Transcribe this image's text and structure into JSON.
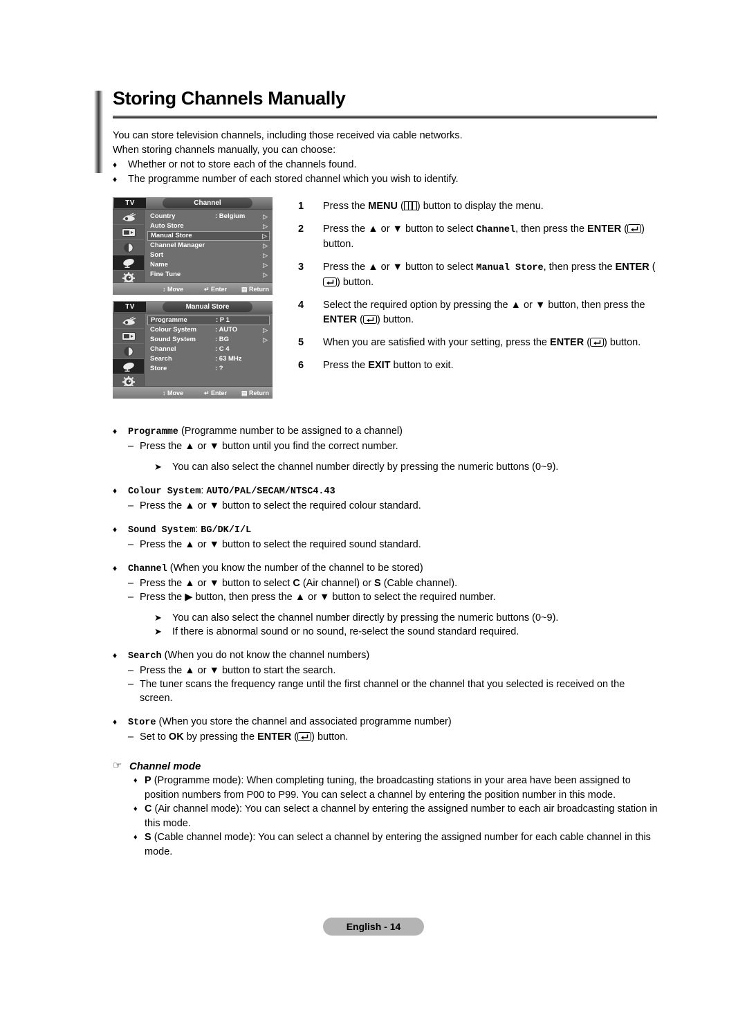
{
  "document": {
    "title": "Storing Channels Manually",
    "intro": [
      "You can store television channels, including those received via cable networks.",
      "When storing channels manually, you can choose:"
    ],
    "intro_bullets": [
      "Whether or not to store each of the channels found.",
      "The programme number of each stored channel which you wish to identify."
    ]
  },
  "osd_menus": [
    {
      "tv_label": "TV",
      "title": "Channel",
      "items": [
        {
          "label": "Country",
          "value": ": Belgium",
          "arrow": "▷",
          "highlighted": false
        },
        {
          "label": "Auto Store",
          "value": "",
          "arrow": "▷",
          "highlighted": false
        },
        {
          "label": "Manual Store",
          "value": "",
          "arrow": "▷",
          "highlighted": true
        },
        {
          "label": "Channel Manager",
          "value": "",
          "arrow": "▷",
          "highlighted": false
        },
        {
          "label": "Sort",
          "value": "",
          "arrow": "▷",
          "highlighted": false
        },
        {
          "label": "Name",
          "value": "",
          "arrow": "▷",
          "highlighted": false
        },
        {
          "label": "Fine Tune",
          "value": "",
          "arrow": "▷",
          "highlighted": false
        }
      ],
      "footer": {
        "move": "Move",
        "enter": "Enter",
        "return": "Return"
      },
      "sidebar_icons": [
        "input-icon",
        "picture-icon",
        "sound-icon",
        "channel-icon",
        "setup-icon"
      ],
      "selected_icon_index": 3
    },
    {
      "tv_label": "TV",
      "title": "Manual Store",
      "items": [
        {
          "label": "Programme",
          "value": ": P   1",
          "arrow": "",
          "highlighted": true
        },
        {
          "label": "Colour System",
          "value": ": AUTO",
          "arrow": "▷",
          "highlighted": false
        },
        {
          "label": "Sound System",
          "value": ": BG",
          "arrow": "▷",
          "highlighted": false
        },
        {
          "label": "Channel",
          "value": ": C   4",
          "arrow": "",
          "highlighted": false
        },
        {
          "label": "Search",
          "value": ":  63 MHz",
          "arrow": "",
          "highlighted": false
        },
        {
          "label": "Store",
          "value": ": ?",
          "arrow": "",
          "highlighted": false
        }
      ],
      "footer": {
        "move": "Move",
        "enter": "Enter",
        "return": "Return"
      },
      "sidebar_icons": [
        "input-icon",
        "picture-icon",
        "sound-icon",
        "channel-icon",
        "setup-icon"
      ],
      "selected_icon_index": 3
    }
  ],
  "steps": [
    {
      "num": "1",
      "parts": [
        {
          "t": "text",
          "v": "Press the "
        },
        {
          "t": "bold",
          "v": "MENU"
        },
        {
          "t": "text",
          "v": " ("
        },
        {
          "t": "icon",
          "v": "menu-icon"
        },
        {
          "t": "text",
          "v": ") button to display the menu."
        }
      ]
    },
    {
      "num": "2",
      "parts": [
        {
          "t": "text",
          "v": "Press the ▲ or ▼ button to select "
        },
        {
          "t": "mono",
          "v": "Channel"
        },
        {
          "t": "text",
          "v": ", then press the "
        },
        {
          "t": "bold",
          "v": "ENTER"
        },
        {
          "t": "text",
          "v": " ("
        },
        {
          "t": "icon",
          "v": "enter-icon"
        },
        {
          "t": "text",
          "v": ") button."
        }
      ]
    },
    {
      "num": "3",
      "parts": [
        {
          "t": "text",
          "v": "Press the ▲ or ▼ button to select "
        },
        {
          "t": "mono",
          "v": "Manual Store"
        },
        {
          "t": "text",
          "v": ", then press the "
        },
        {
          "t": "bold",
          "v": "ENTER"
        },
        {
          "t": "text",
          "v": " ("
        },
        {
          "t": "icon",
          "v": "enter-icon"
        },
        {
          "t": "text",
          "v": ") button."
        }
      ]
    },
    {
      "num": "4",
      "parts": [
        {
          "t": "text",
          "v": "Select the required option by pressing the ▲ or ▼ button, then press the "
        },
        {
          "t": "bold",
          "v": "ENTER"
        },
        {
          "t": "text",
          "v": " ("
        },
        {
          "t": "icon",
          "v": "enter-icon"
        },
        {
          "t": "text",
          "v": ") button."
        }
      ]
    },
    {
      "num": "5",
      "parts": [
        {
          "t": "text",
          "v": "When you are satisfied with your setting, press the "
        },
        {
          "t": "bold",
          "v": "ENTER"
        },
        {
          "t": "text",
          "v": " ("
        },
        {
          "t": "icon",
          "v": "enter-icon"
        },
        {
          "t": "text",
          "v": ") button."
        }
      ]
    },
    {
      "num": "6",
      "parts": [
        {
          "t": "text",
          "v": "Press the "
        },
        {
          "t": "bold",
          "v": "EXIT"
        },
        {
          "t": "text",
          "v": " button to exit."
        }
      ]
    }
  ],
  "options": [
    {
      "head": [
        {
          "t": "mono",
          "v": "Programme"
        },
        {
          "t": "text",
          "v": " (Programme number to be assigned to a channel)"
        }
      ],
      "dashes": [
        [
          {
            "t": "text",
            "v": "Press the ▲ or ▼ button until you find the correct number."
          }
        ]
      ],
      "notes": [
        "You can also select the channel number directly by pressing the numeric buttons (0~9)."
      ]
    },
    {
      "head": [
        {
          "t": "mono",
          "v": "Colour System"
        },
        {
          "t": "text",
          "v": ": "
        },
        {
          "t": "mono",
          "v": "AUTO/PAL/SECAM/NTSC4.43"
        }
      ],
      "dashes": [
        [
          {
            "t": "text",
            "v": "Press the ▲ or ▼ button to select the required colour standard."
          }
        ]
      ],
      "notes": []
    },
    {
      "head": [
        {
          "t": "mono",
          "v": "Sound System"
        },
        {
          "t": "text",
          "v": ": "
        },
        {
          "t": "mono",
          "v": "BG/DK/I/L"
        }
      ],
      "dashes": [
        [
          {
            "t": "text",
            "v": "Press the ▲ or ▼ button to select the required sound standard."
          }
        ]
      ],
      "notes": []
    },
    {
      "head": [
        {
          "t": "mono",
          "v": "Channel"
        },
        {
          "t": "text",
          "v": " (When you know the number of the channel to be stored)"
        }
      ],
      "dashes": [
        [
          {
            "t": "text",
            "v": "Press the ▲ or ▼ button to select "
          },
          {
            "t": "bold",
            "v": "C"
          },
          {
            "t": "text",
            "v": " (Air channel) or "
          },
          {
            "t": "bold",
            "v": "S"
          },
          {
            "t": "text",
            "v": " (Cable channel)."
          }
        ],
        [
          {
            "t": "text",
            "v": "Press the ▶ button, then press the ▲ or ▼ button to select the required number."
          }
        ]
      ],
      "notes": [
        "You can also select the channel number directly by pressing the numeric buttons (0~9).",
        "If there is abnormal sound or no sound, re-select the sound standard required."
      ]
    },
    {
      "head": [
        {
          "t": "mono",
          "v": "Search"
        },
        {
          "t": "text",
          "v": " (When you do not know the channel numbers)"
        }
      ],
      "dashes": [
        [
          {
            "t": "text",
            "v": "Press the ▲ or ▼ button to start the search."
          }
        ],
        [
          {
            "t": "text",
            "v": "The tuner scans the frequency range until the first channel or the channel that you selected is received on the screen."
          }
        ]
      ],
      "notes": []
    },
    {
      "head": [
        {
          "t": "mono",
          "v": "Store"
        },
        {
          "t": "text",
          "v": " (When you store the channel and associated programme number)"
        }
      ],
      "dashes": [
        [
          {
            "t": "text",
            "v": "Set to "
          },
          {
            "t": "bold",
            "v": "OK"
          },
          {
            "t": "text",
            "v": " by pressing the "
          },
          {
            "t": "bold",
            "v": "ENTER"
          },
          {
            "t": "text",
            "v": " ("
          },
          {
            "t": "icon",
            "v": "enter-icon"
          },
          {
            "t": "text",
            "v": ") button."
          }
        ]
      ],
      "notes": []
    }
  ],
  "channel_mode": {
    "marker": "pointing-hand-icon",
    "title": "Channel mode",
    "items": [
      [
        {
          "t": "bold",
          "v": "P"
        },
        {
          "t": "text",
          "v": " (Programme mode): When completing tuning, the broadcasting stations in your area have been assigned to position numbers from P00 to P99. You can select a channel by entering the position number in this mode."
        }
      ],
      [
        {
          "t": "bold",
          "v": "C"
        },
        {
          "t": "text",
          "v": " (Air channel mode): You can select a channel by entering the assigned number to each air broadcasting station in this mode."
        }
      ],
      [
        {
          "t": "bold",
          "v": "S"
        },
        {
          "t": "text",
          "v": " (Cable channel mode): You can select a channel by entering the assigned number for each cable channel in this mode."
        }
      ]
    ]
  },
  "footer": {
    "page_label": "English - 14"
  },
  "glyphs": {
    "diamond": "♦",
    "dash": "–",
    "note_arrow": "➤",
    "hand": "☞",
    "up": "▲",
    "down": "▼",
    "right_tri": "▶",
    "menu_arrow": "↕"
  },
  "colors": {
    "osd_bg": "#6f6f6f",
    "osd_sidebar": "#5c5c5c",
    "osd_selected": "#232323",
    "page_pill": "#b4b4b4",
    "text": "#000000"
  }
}
